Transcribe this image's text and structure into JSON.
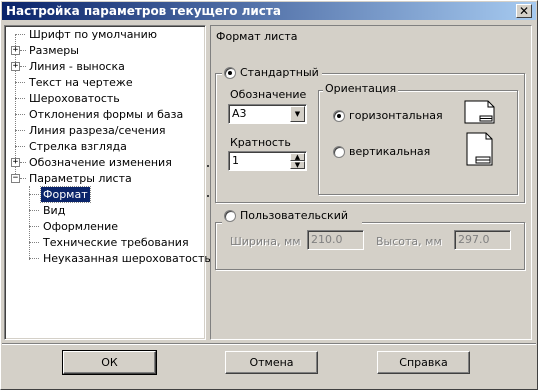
{
  "window": {
    "title": "Настройка параметров текущего листа",
    "close_glyph": "✕"
  },
  "tree": {
    "items": [
      {
        "label": "Шрифт по умолчанию",
        "expander": ""
      },
      {
        "label": "Размеры",
        "expander": "+"
      },
      {
        "label": "Линия - выноска",
        "expander": "+"
      },
      {
        "label": "Текст на чертеже",
        "expander": ""
      },
      {
        "label": "Шероховатость",
        "expander": ""
      },
      {
        "label": "Отклонения формы и база",
        "expander": ""
      },
      {
        "label": "Линия разреза/сечения",
        "expander": ""
      },
      {
        "label": "Стрелка взгляда",
        "expander": ""
      },
      {
        "label": "Обозначение изменения",
        "expander": "+"
      },
      {
        "label": "Параметры листа",
        "expander": "−"
      }
    ],
    "children": [
      {
        "label": "Формат",
        "selected": true
      },
      {
        "label": "Вид",
        "selected": false
      },
      {
        "label": "Оформление",
        "selected": false
      },
      {
        "label": "Технические требования",
        "selected": false
      },
      {
        "label": "Неуказанная шероховатость",
        "selected": false
      }
    ]
  },
  "format_panel": {
    "section_title": "Формат листа",
    "standard": {
      "label": "Стандартный",
      "selected": true,
      "designation_label": "Обозначение",
      "designation_value": "А3",
      "multiplicity_label": "Кратность",
      "multiplicity_value": "1",
      "orientation": {
        "label": "Ориентация",
        "horizontal_label": "горизонтальная",
        "vertical_label": "вертикальная",
        "selected": "horizontal",
        "horizontal_icon": "landscape-sheet-icon",
        "vertical_icon": "portrait-sheet-icon"
      }
    },
    "custom": {
      "label": "Пользовательский",
      "selected": false,
      "width_label": "Ширина, мм",
      "width_value": "210.0",
      "height_label": "Высота, мм",
      "height_value": "297.0"
    }
  },
  "buttons": {
    "ok": "ОК",
    "cancel": "Отмена",
    "help": "Справка"
  },
  "colors": {
    "title_bar": "#0a246a",
    "face": "#d4d0c8",
    "selection": "#0a246a"
  }
}
